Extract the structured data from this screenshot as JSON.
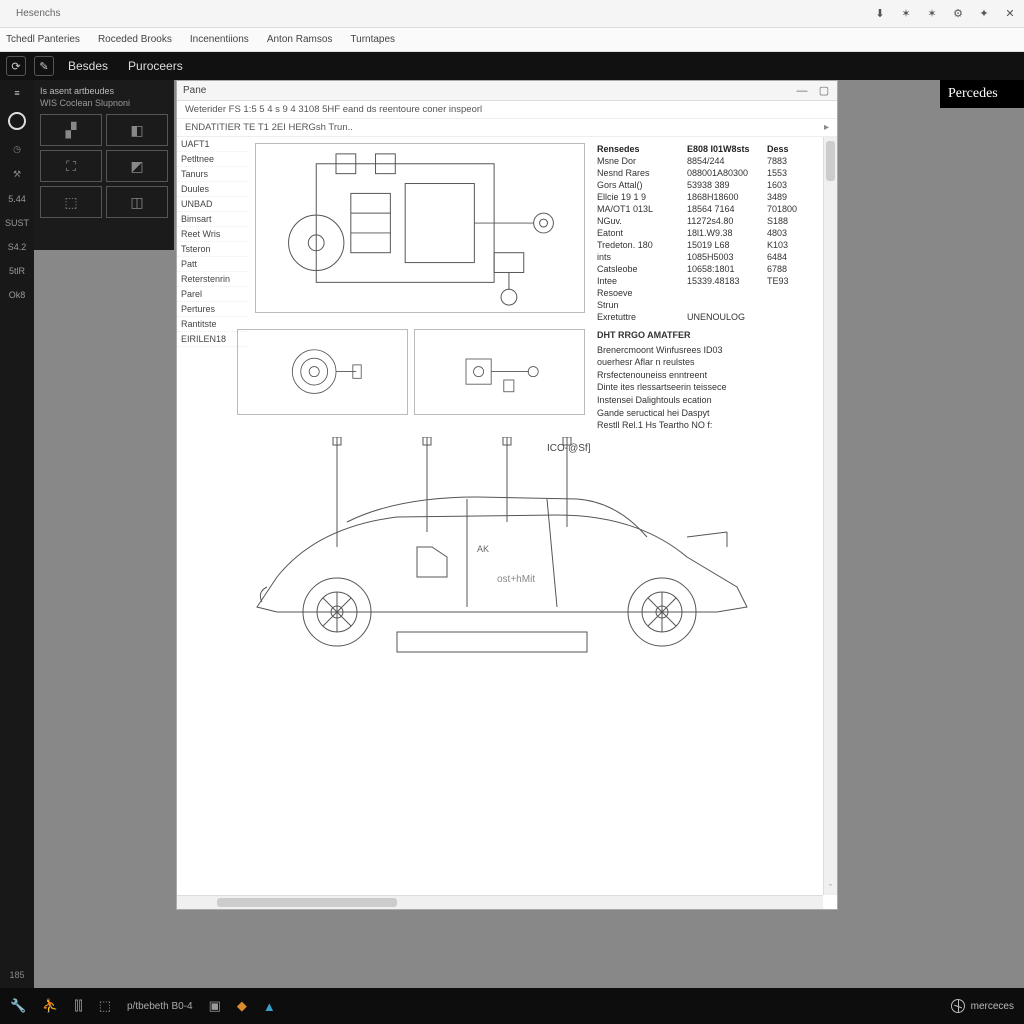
{
  "browser": {
    "tab_title": "Hesenchs",
    "icons": [
      "down",
      "star",
      "star",
      "gear",
      "star",
      "x"
    ]
  },
  "menu": [
    "Tchedl Panteries",
    "Roceded Brooks",
    "Incenentiions",
    "Anton Ramsos",
    "Turntapes"
  ],
  "appbar": {
    "tabs": [
      "Besdes",
      "Puroceers"
    ]
  },
  "brand_right": "Percedes",
  "left_rail": {
    "items": [
      "5.44",
      "SUST",
      "S4.2",
      "5tlR",
      "Ok8"
    ],
    "bottom": "185"
  },
  "side_panel": {
    "title": "Is asent artbeudes",
    "subtitle": "WIS Coclean Slupnoni"
  },
  "doc": {
    "pane_title": "Pane",
    "sub1": "Weterider FS 1:5 5 4 s 9 4 3108 5HF eand ds reentoure coner inspeorl",
    "sub2": "ENDATITIER TE T1 2EI HERGsh Trun..",
    "nav": [
      "UAFT1",
      "Petltnee",
      "Tanurs",
      "Duules",
      "UNBAD",
      "Bimsart",
      "Reet Wris",
      "Tsteron",
      "Patt",
      "Reterstenrin",
      "Parel",
      "Pertures",
      "Rantitste",
      "EIRILEN18"
    ],
    "table": {
      "headers": [
        "Rensedes",
        "E808 I01W8sts",
        "Dess"
      ],
      "rows": [
        [
          "Msne Dor",
          "8854/244",
          "7883"
        ],
        [
          "Nesnd Rares",
          "088001A80300",
          "1553"
        ],
        [
          "Gors Attal()",
          "53938 389",
          "1603"
        ],
        [
          "Ellcie 19 1 9",
          "1868H18600",
          "3489"
        ],
        [
          "MA/OT1 013L",
          "18564 7164",
          "701800"
        ],
        [
          "NGuv.",
          "11272s4.80",
          "S188"
        ],
        [
          "Eatont",
          "18l1.W9.38",
          "4803"
        ],
        [
          "Tredeton. 180",
          "15019 L68",
          "K103"
        ],
        [
          "ints",
          "1085H5003",
          "6484"
        ],
        [
          "Catsleobe",
          "10658:1801",
          "6788"
        ],
        [
          "Intee",
          "15339.48183",
          "TE93"
        ],
        [
          "Resoeve",
          "",
          ""
        ],
        [
          "Strun",
          "",
          ""
        ],
        [
          "Exretuttre",
          "UNENOULOG",
          ""
        ]
      ]
    },
    "notes": {
      "title": "DHT RRGO AMATFER",
      "lines": [
        "Brenercmoont Winfusrees ID03",
        "ouerhesr Aflar n reulstes",
        "Rrsfectenouneiss enntreent",
        "Dinte ites rlessartseerin teissece",
        "Instensei Dalightouls ecation",
        "Gande seructical hei Daspyt",
        "Restll Rel.1 Hs Teartho NO f:"
      ]
    },
    "car_label": "ICO-@Sf]"
  },
  "taskbar": {
    "label": "p/tbebeth B0-4",
    "brand": "merceces"
  }
}
